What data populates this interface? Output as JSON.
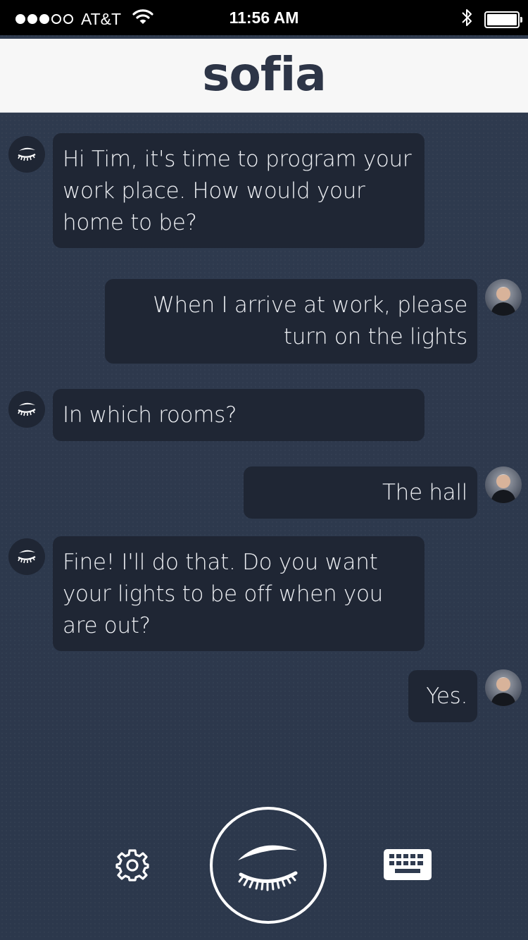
{
  "status_bar": {
    "carrier": "AT&T",
    "signal_bars_filled": 3,
    "signal_bars_total": 5,
    "time": "11:56 AM",
    "battery_level": 1.0
  },
  "header": {
    "title": "sofia"
  },
  "messages": [
    {
      "sender": "sofia",
      "text": "Hi Tim, it's time to program your work place. How would your home to be?"
    },
    {
      "sender": "user",
      "text": "When I arrive at work, please turn on the lights"
    },
    {
      "sender": "sofia",
      "text": "In which rooms?"
    },
    {
      "sender": "user",
      "text": "The hall"
    },
    {
      "sender": "sofia",
      "text": "Fine! I'll do that. Do you want your lights to be off when you are out?"
    },
    {
      "sender": "user",
      "text": "Yes."
    }
  ],
  "icons": {
    "settings": "gear-icon",
    "mic": "closed-eye-icon",
    "keyboard": "keyboard-icon",
    "sofia_avatar": "closed-eye-icon",
    "user_avatar": "user-photo"
  },
  "colors": {
    "background": "#2f3b4f",
    "bubble": "#1f2634",
    "header": "#f7f7f7",
    "title": "#2d3547"
  }
}
